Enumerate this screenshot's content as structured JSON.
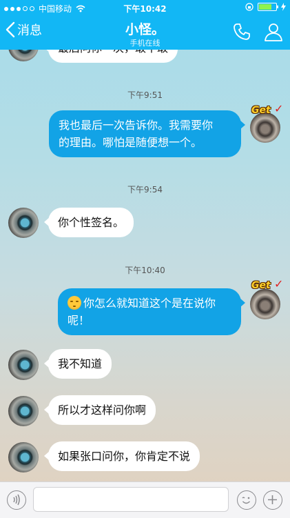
{
  "status_bar": {
    "carrier": "中国移动",
    "time": "下午10:42"
  },
  "header": {
    "back_label": "消息",
    "title": "小怪。",
    "subtitle": "手机在线"
  },
  "messages": [
    {
      "type": "in",
      "text": "最后问你一次，敢不敢"
    },
    {
      "type": "timestamp",
      "text": "下午9:51"
    },
    {
      "type": "out",
      "text": "我也最后一次告诉你。我需要你的理由。哪怕是随便想一个。",
      "line1": "我也最后一次告诉你。我需要你",
      "line2": "的理由。哪怕是随便想一个。",
      "badge": "Get"
    },
    {
      "type": "timestamp",
      "text": "下午9:54"
    },
    {
      "type": "in",
      "text": "你个性签名。"
    },
    {
      "type": "timestamp",
      "text": "下午10:40"
    },
    {
      "type": "out",
      "text": "你怎么就知道这个是在说你呢！",
      "line1": "你怎么就知道这个是在说你",
      "line2": "呢！",
      "emoji": "sad-face",
      "badge": "Get"
    },
    {
      "type": "in",
      "text": "我不知道"
    },
    {
      "type": "in",
      "text": "所以才这样问你啊"
    },
    {
      "type": "in",
      "text": "如果张口问你，你肯定不说"
    }
  ],
  "colors": {
    "header": "#12b7f5",
    "outgoing_bubble": "#12a3e6",
    "incoming_bubble": "#ffffff"
  }
}
